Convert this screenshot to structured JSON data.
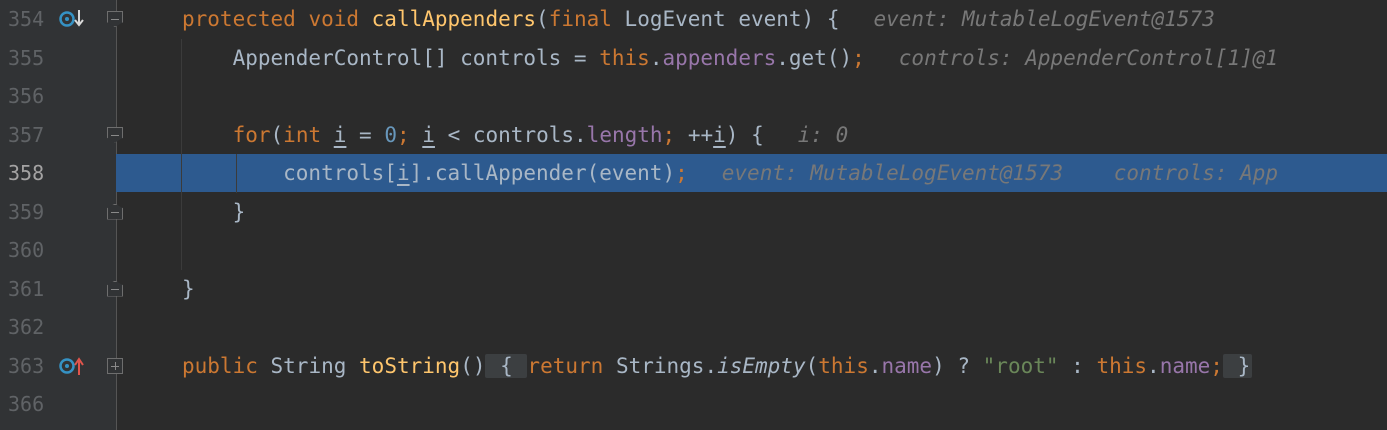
{
  "editor": {
    "lines": [
      {
        "num": "354",
        "tokens": [
          {
            "t": "protected ",
            "c": "kw"
          },
          {
            "t": "void ",
            "c": "kw"
          },
          {
            "t": "callAppenders",
            "c": "fn"
          },
          {
            "t": "(",
            "c": ""
          },
          {
            "t": "final ",
            "c": "kw"
          },
          {
            "t": "LogEvent event) {",
            "c": ""
          }
        ],
        "hint": "event: MutableLogEvent@1573"
      },
      {
        "num": "355",
        "tokens": [
          {
            "t": "    AppenderControl[] controls = ",
            "c": ""
          },
          {
            "t": "this",
            "c": "kw"
          },
          {
            "t": ".",
            "c": ""
          },
          {
            "t": "appenders",
            "c": "fld"
          },
          {
            "t": ".get()",
            "c": ""
          },
          {
            "t": ";",
            "c": "kw"
          }
        ],
        "hint": "controls: AppenderControl[1]@1"
      },
      {
        "num": "356",
        "tokens": [],
        "hint": ""
      },
      {
        "num": "357",
        "tokens": [
          {
            "t": "    ",
            "c": ""
          },
          {
            "t": "for",
            "c": "kw"
          },
          {
            "t": "(",
            "c": ""
          },
          {
            "t": "int ",
            "c": "kw"
          },
          {
            "t": "i",
            "c": "u"
          },
          {
            "t": " = ",
            "c": ""
          },
          {
            "t": "0",
            "c": "num"
          },
          {
            "t": "; ",
            "c": "kw"
          },
          {
            "t": "i",
            "c": "u"
          },
          {
            "t": " < controls.",
            "c": ""
          },
          {
            "t": "length",
            "c": "fld"
          },
          {
            "t": "; ",
            "c": "kw"
          },
          {
            "t": "++",
            "c": ""
          },
          {
            "t": "i",
            "c": "u"
          },
          {
            "t": ") {",
            "c": ""
          }
        ],
        "hint": "i: 0"
      },
      {
        "num": "358",
        "tokens": [
          {
            "t": "        controls[",
            "c": ""
          },
          {
            "t": "i",
            "c": "u"
          },
          {
            "t": "].callAppender(event)",
            "c": ""
          },
          {
            "t": ";",
            "c": "kw"
          }
        ],
        "hint": "event: MutableLogEvent@1573    controls: App"
      },
      {
        "num": "359",
        "tokens": [
          {
            "t": "    }",
            "c": ""
          }
        ],
        "hint": ""
      },
      {
        "num": "360",
        "tokens": [],
        "hint": ""
      },
      {
        "num": "361",
        "tokens": [
          {
            "t": "}",
            "c": ""
          }
        ],
        "hint": ""
      },
      {
        "num": "362",
        "tokens": [],
        "hint": ""
      },
      {
        "num": "363",
        "tokens": [
          {
            "t": "public ",
            "c": "kw"
          },
          {
            "t": "String ",
            "c": ""
          },
          {
            "t": "toString",
            "c": "fn"
          },
          {
            "t": "()",
            "c": ""
          },
          {
            "t": " { ",
            "c": "brace"
          },
          {
            "t": "return ",
            "c": "kw"
          },
          {
            "t": "Strings.",
            "c": ""
          },
          {
            "t": "isEmpty",
            "c": "it"
          },
          {
            "t": "(",
            "c": ""
          },
          {
            "t": "this",
            "c": "kw"
          },
          {
            "t": ".",
            "c": ""
          },
          {
            "t": "name",
            "c": "fld"
          },
          {
            "t": ") ? ",
            "c": ""
          },
          {
            "t": "\"root\"",
            "c": "str"
          },
          {
            "t": " : ",
            "c": ""
          },
          {
            "t": "this",
            "c": "kw"
          },
          {
            "t": ".",
            "c": ""
          },
          {
            "t": "name",
            "c": "fld"
          },
          {
            "t": ";",
            "c": "kw"
          },
          {
            "t": " }",
            "c": "brace"
          }
        ],
        "hint": ""
      },
      {
        "num": "366",
        "tokens": [],
        "hint": ""
      }
    ],
    "current_line": "358",
    "gutter_icons": [
      {
        "line": "354",
        "name": "overriding-method-icon"
      },
      {
        "line": "363",
        "name": "overrides-method-icon"
      }
    ]
  },
  "colors": {
    "background": "#2b2b2b",
    "gutter": "#313335",
    "current_line": "#2d5a8f",
    "keyword": "#cc7832",
    "function": "#ffc66d",
    "field": "#9876aa",
    "string": "#6a8759",
    "number": "#6897bb",
    "hint": "#787878"
  }
}
